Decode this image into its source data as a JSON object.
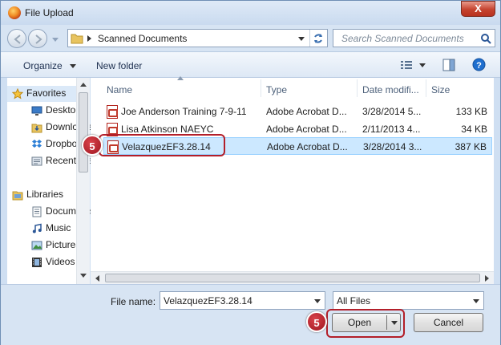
{
  "window": {
    "title": "File Upload",
    "close_glyph": "X"
  },
  "navbar": {
    "breadcrumb": "Scanned Documents",
    "search_placeholder": "Search Scanned Documents"
  },
  "toolbar": {
    "organize": "Organize",
    "new_folder": "New folder"
  },
  "sidebar": {
    "items": [
      {
        "label": "Favorites",
        "icon": "star-icon"
      },
      {
        "label": "Desktop",
        "icon": "desktop-icon"
      },
      {
        "label": "Downloads",
        "icon": "downloads-icon"
      },
      {
        "label": "Dropbox",
        "icon": "dropbox-icon"
      },
      {
        "label": "Recent Places",
        "icon": "recent-icon"
      },
      {
        "label": "Libraries",
        "icon": "libraries-icon"
      },
      {
        "label": "Documents",
        "icon": "documents-icon"
      },
      {
        "label": "Music",
        "icon": "music-icon"
      },
      {
        "label": "Pictures",
        "icon": "pictures-icon"
      },
      {
        "label": "Videos",
        "icon": "videos-icon"
      }
    ]
  },
  "columns": {
    "name": "Name",
    "type": "Type",
    "date": "Date modifi...",
    "size": "Size"
  },
  "files": [
    {
      "name": "Joe Anderson Training 7-9-11",
      "type": "Adobe Acrobat D...",
      "date": "3/28/2014 5...",
      "size": "133 KB"
    },
    {
      "name": "Lisa Atkinson NAEYC",
      "type": "Adobe Acrobat D...",
      "date": "2/11/2013 4...",
      "size": "34 KB"
    },
    {
      "name": "VelazquezEF3.28.14",
      "type": "Adobe Acrobat D...",
      "date": "3/28/2014 3...",
      "size": "387 KB"
    }
  ],
  "bottom": {
    "file_name_label": "File name:",
    "file_name_value": "VelazquezEF3.28.14",
    "file_type_value": "All Files",
    "open_label": "Open",
    "cancel_label": "Cancel"
  },
  "callouts": {
    "step_file": "5",
    "step_open": "5"
  },
  "colors": {
    "callout": "#b31f2a",
    "selection": "#cce8ff",
    "help": "#1f6fcf"
  }
}
